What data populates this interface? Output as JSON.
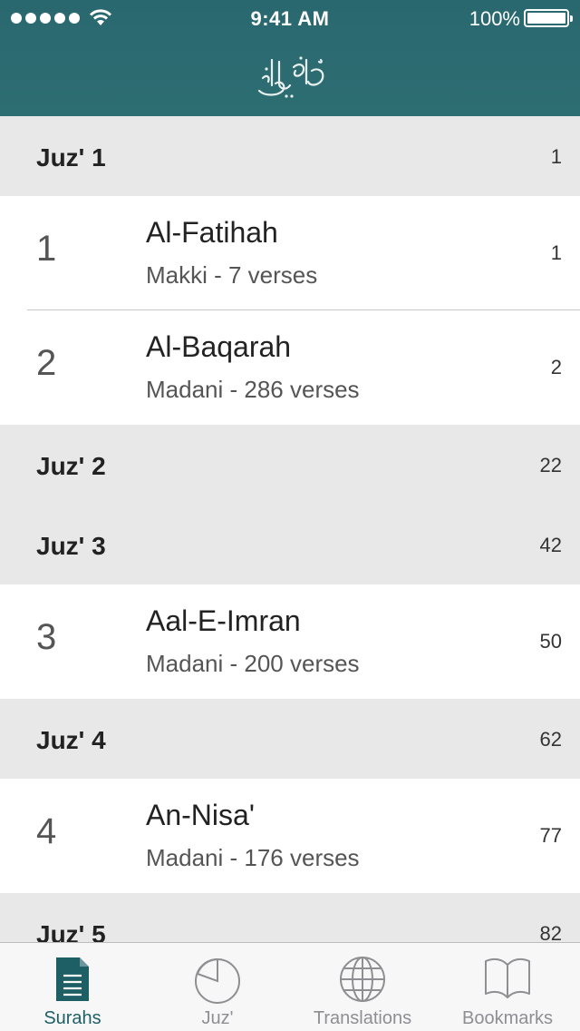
{
  "status_bar": {
    "time": "9:41 AM",
    "battery": "100%"
  },
  "app": {
    "title_logo": "القرآن الكريم"
  },
  "list": [
    {
      "kind": "juz",
      "title": "Juz' 1",
      "page": "1"
    },
    {
      "kind": "surah",
      "number": "1",
      "name": "Al-Fatihah",
      "info": "Makki - 7 verses",
      "page": "1"
    },
    {
      "kind": "surah",
      "number": "2",
      "name": "Al-Baqarah",
      "info": "Madani - 286 verses",
      "page": "2"
    },
    {
      "kind": "juz",
      "title": "Juz' 2",
      "page": "22"
    },
    {
      "kind": "juz",
      "title": "Juz' 3",
      "page": "42"
    },
    {
      "kind": "surah",
      "number": "3",
      "name": "Aal-E-Imran",
      "info": "Madani - 200 verses",
      "page": "50"
    },
    {
      "kind": "juz",
      "title": "Juz' 4",
      "page": "62"
    },
    {
      "kind": "surah",
      "number": "4",
      "name": "An-Nisa'",
      "info": "Madani - 176 verses",
      "page": "77"
    },
    {
      "kind": "juz",
      "title": "Juz' 5",
      "page": "82"
    }
  ],
  "tabs": [
    {
      "label": "Surahs",
      "icon": "document-icon",
      "active": true
    },
    {
      "label": "Juz'",
      "icon": "pie-icon",
      "active": false
    },
    {
      "label": "Translations",
      "icon": "globe-icon",
      "active": false
    },
    {
      "label": "Bookmarks",
      "icon": "book-icon",
      "active": false
    }
  ],
  "colors": {
    "header": "#2d6e72",
    "accent": "#1e5f66",
    "section_bg": "#e8e8e8"
  }
}
